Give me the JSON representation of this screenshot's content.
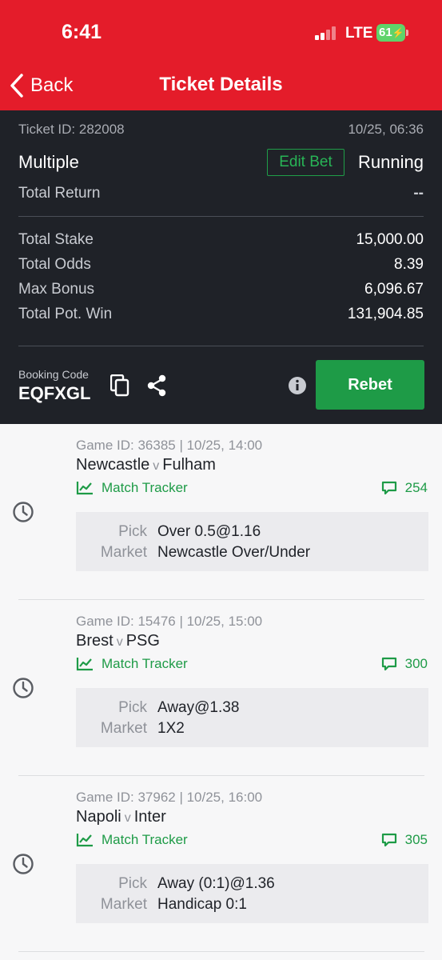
{
  "status_bar": {
    "time": "6:41",
    "network": "LTE",
    "battery": "61"
  },
  "nav": {
    "back_label": "Back",
    "title": "Ticket Details"
  },
  "ticket": {
    "id_label": "Ticket ID: 282008",
    "datetime": "10/25, 06:36",
    "type": "Multiple",
    "edit_label": "Edit Bet",
    "status": "Running",
    "total_return_label": "Total Return",
    "total_return_value": "--",
    "total_stake_label": "Total Stake",
    "total_stake_value": "15,000.00",
    "total_odds_label": "Total Odds",
    "total_odds_value": "8.39",
    "max_bonus_label": "Max Bonus",
    "max_bonus_value": "6,096.67",
    "pot_win_label": "Total Pot. Win",
    "pot_win_value": "131,904.85",
    "booking_label": "Booking Code",
    "booking_code": "EQFXGL",
    "rebet_label": "Rebet"
  },
  "selections": [
    {
      "game_line": "Game ID: 36385 | 10/25, 14:00",
      "home": "Newcastle",
      "vs": "v",
      "away": "Fulham",
      "tracker_label": "Match Tracker",
      "comments": "254",
      "pick_label": "Pick",
      "pick": "Over 0.5@1.16",
      "market_label": "Market",
      "market": "Newcastle Over/Under"
    },
    {
      "game_line": "Game ID: 15476 | 10/25, 15:00",
      "home": "Brest",
      "vs": "v",
      "away": "PSG",
      "tracker_label": "Match Tracker",
      "comments": "300",
      "pick_label": "Pick",
      "pick": "Away@1.38",
      "market_label": "Market",
      "market": "1X2"
    },
    {
      "game_line": "Game ID: 37962 | 10/25, 16:00",
      "home": "Napoli",
      "vs": "v",
      "away": "Inter",
      "tracker_label": "Match Tracker",
      "comments": "305",
      "pick_label": "Pick",
      "pick": "Away (0:1)@1.36",
      "market_label": "Market",
      "market": "Handicap 0:1"
    }
  ],
  "colors": {
    "header": "#e41c2a",
    "panel": "#1f2228",
    "accent_green": "#1e9b47"
  }
}
